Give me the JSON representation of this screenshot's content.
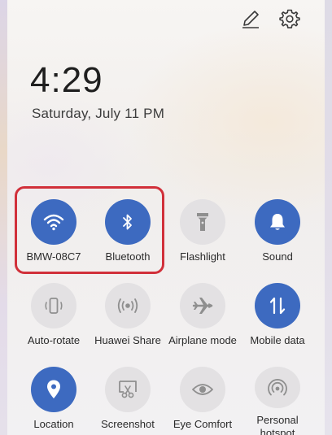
{
  "clock": {
    "time": "4:29",
    "date": "Saturday, July 11  PM"
  },
  "header": {
    "edit_icon": "pencil-icon",
    "settings_icon": "gear-icon"
  },
  "colors": {
    "active_tile": "#3d6ac0",
    "inactive_tile": "#e3e1e3",
    "highlight": "#d1303a"
  },
  "tiles": [
    {
      "label": "BMW-08C7",
      "icon": "wifi-icon",
      "active": true
    },
    {
      "label": "Bluetooth",
      "icon": "bluetooth-icon",
      "active": true
    },
    {
      "label": "Flashlight",
      "icon": "flashlight-icon",
      "active": false
    },
    {
      "label": "Sound",
      "icon": "bell-icon",
      "active": true
    },
    {
      "label": "Auto-rotate",
      "icon": "auto-rotate-icon",
      "active": false
    },
    {
      "label": "Huawei Share",
      "icon": "huawei-share-icon",
      "active": false
    },
    {
      "label": "Airplane mode",
      "icon": "airplane-icon",
      "active": false
    },
    {
      "label": "Mobile data",
      "icon": "mobile-data-icon",
      "active": true
    },
    {
      "label": "Location",
      "icon": "location-icon",
      "active": true
    },
    {
      "label": "Screenshot",
      "icon": "screenshot-icon",
      "active": false
    },
    {
      "label": "Eye Comfort",
      "icon": "eye-icon",
      "active": false
    },
    {
      "label": "Personal hotspot",
      "icon": "hotspot-icon",
      "active": false
    }
  ]
}
